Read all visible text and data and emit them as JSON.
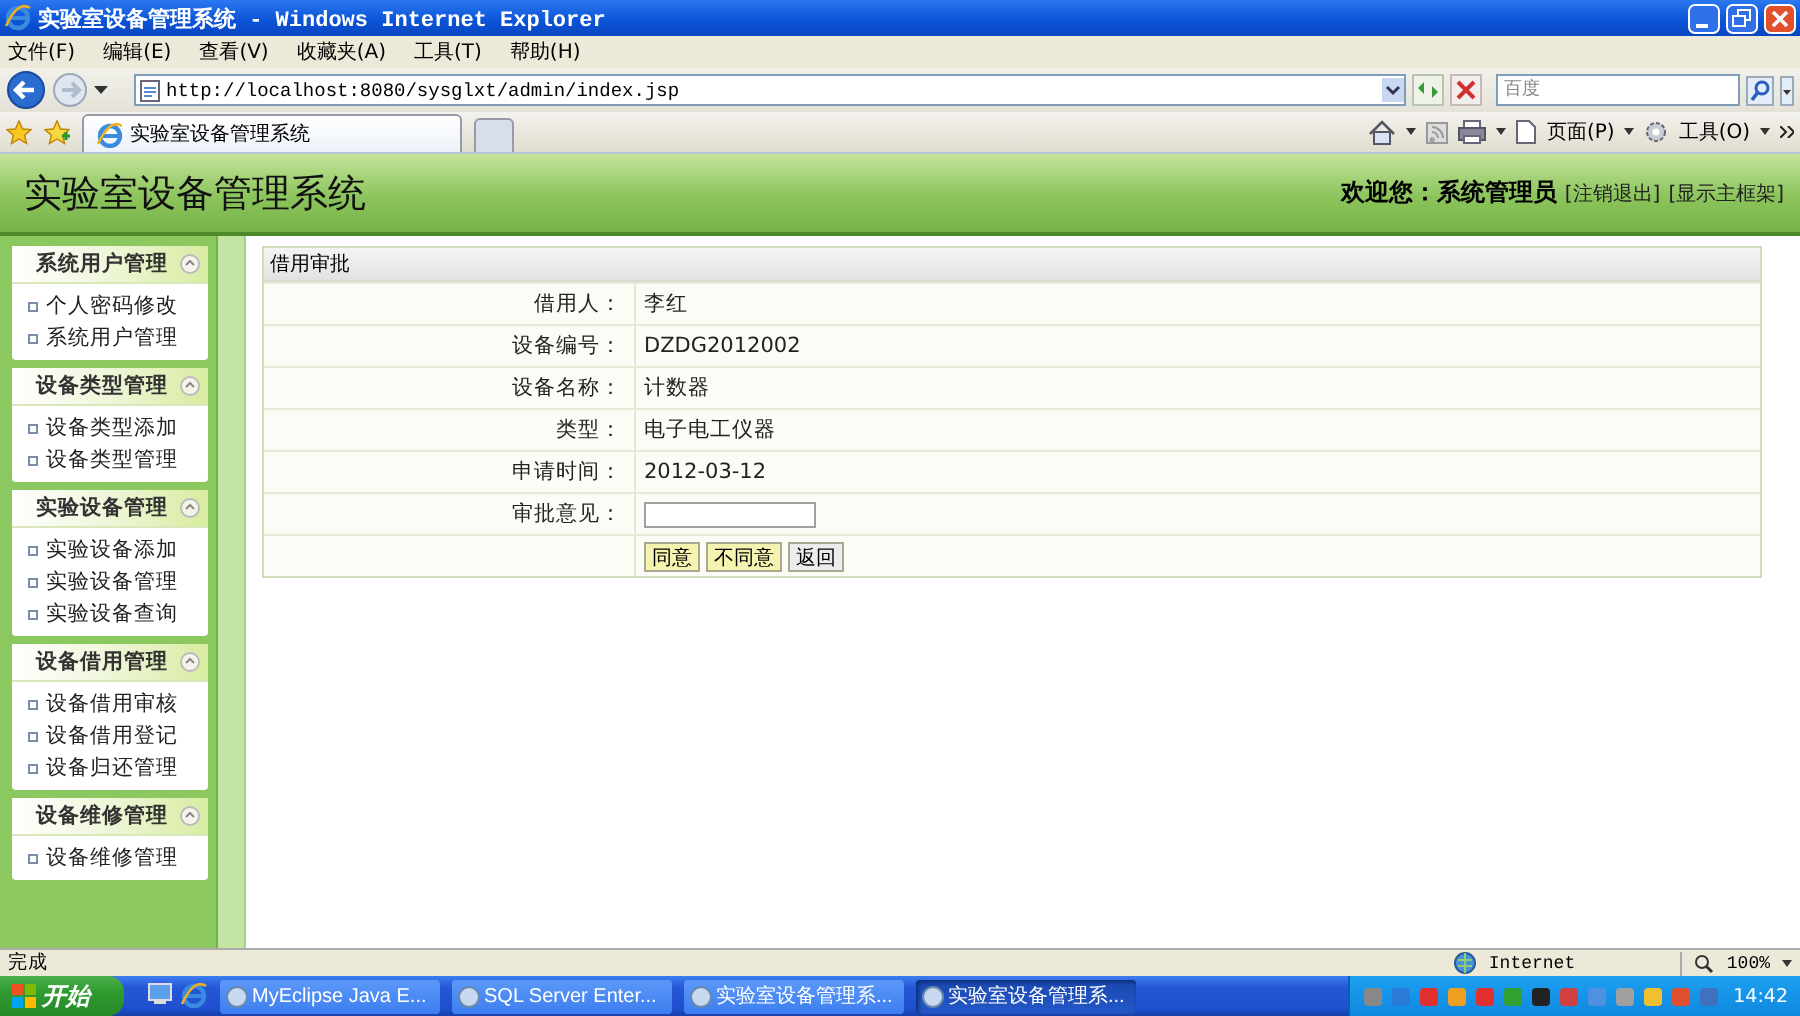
{
  "window": {
    "title": "实验室设备管理系统 - Windows Internet Explorer"
  },
  "menu": [
    "文件(F)",
    "编辑(E)",
    "查看(V)",
    "收藏夹(A)",
    "工具(T)",
    "帮助(H)"
  ],
  "address": {
    "url": "http://localhost:8080/sysglxt/admin/index.jsp",
    "search_placeholder": "百度"
  },
  "browser_tabs": [
    {
      "title": "实验室设备管理系统",
      "selected": true
    }
  ],
  "command_bar": [
    "页面(P)",
    "工具(O)"
  ],
  "app": {
    "title": "实验室设备管理系统",
    "welcome": "欢迎您：系统管理员",
    "links": [
      "[注销退出]",
      "[显示主框架]"
    ]
  },
  "sidebar": [
    {
      "title": "系统用户管理",
      "expanded": true,
      "items": [
        "个人密码修改",
        "系统用户管理"
      ]
    },
    {
      "title": "设备类型管理",
      "expanded": true,
      "items": [
        "设备类型添加",
        "设备类型管理"
      ]
    },
    {
      "title": "实验设备管理",
      "expanded": true,
      "items": [
        "实验设备添加",
        "实验设备管理",
        "实验设备查询"
      ]
    },
    {
      "title": "设备借用管理",
      "expanded": true,
      "items": [
        "设备借用审核",
        "设备借用登记",
        "设备归还管理"
      ]
    },
    {
      "title": "设备维修管理",
      "expanded": true,
      "items": [
        "设备维修管理"
      ]
    }
  ],
  "form": {
    "title": "借用审批",
    "fields": [
      {
        "kind": "text",
        "label": "借用人：",
        "value": "李红"
      },
      {
        "kind": "text",
        "label": "设备编号：",
        "value": "DZDG2012002"
      },
      {
        "kind": "text",
        "label": "设备名称：",
        "value": "计数器"
      },
      {
        "kind": "text",
        "label": "类型：",
        "value": "电子电工仪器"
      },
      {
        "kind": "text",
        "label": "申请时间：",
        "value": "2012-03-12"
      },
      {
        "kind": "input",
        "label": "审批意见："
      }
    ],
    "buttons": [
      {
        "label": "同意",
        "highlighted": true
      },
      {
        "label": "不同意",
        "highlighted": true
      },
      {
        "label": "返回",
        "highlighted": false
      }
    ]
  },
  "status_bar": {
    "text": "完成",
    "zone": "Internet",
    "zoom": "100%"
  },
  "taskbar": {
    "start": "开始",
    "tasks": [
      {
        "title": "MyEclipse Java E...",
        "selected": false
      },
      {
        "title": "SQL Server Enter...",
        "selected": false
      },
      {
        "title": "实验室设备管理系...",
        "selected": false
      },
      {
        "title": "实验室设备管理系...",
        "selected": true
      }
    ],
    "clock": "14:42"
  }
}
